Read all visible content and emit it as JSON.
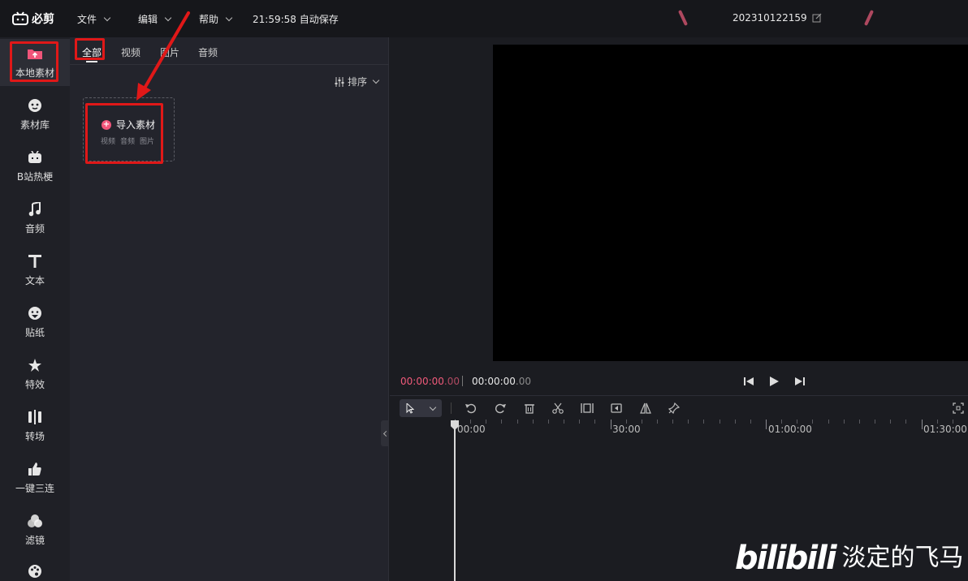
{
  "app": {
    "logo_text": "必剪",
    "menus": [
      "文件",
      "编辑",
      "帮助"
    ],
    "autosave": "21:59:58 自动保存",
    "project_name": "202310122159"
  },
  "sidebar": {
    "items": [
      {
        "label": "本地素材",
        "icon": "upload-folder-icon"
      },
      {
        "label": "素材库",
        "icon": "face-icon"
      },
      {
        "label": "B站热梗",
        "icon": "tv-icon"
      },
      {
        "label": "音频",
        "icon": "music-note-icon"
      },
      {
        "label": "文本",
        "icon": "text-t-icon"
      },
      {
        "label": "贴纸",
        "icon": "sticker-icon"
      },
      {
        "label": "特效",
        "icon": "star-icon"
      },
      {
        "label": "转场",
        "icon": "transition-icon"
      },
      {
        "label": "一键三连",
        "icon": "thumbs-up-icon"
      },
      {
        "label": "滤镜",
        "icon": "filter-icon"
      },
      {
        "label": "",
        "icon": "palette-icon"
      }
    ]
  },
  "media": {
    "tabs": [
      "全部",
      "视频",
      "图片",
      "音频"
    ],
    "sort_label": "排序",
    "import": {
      "title": "导入素材",
      "types": [
        "视频",
        "音频",
        "图片"
      ]
    }
  },
  "player": {
    "current_main": "00:00:00",
    "current_ms": ".00",
    "total_main": "00:00:00",
    "total_ms": ".00"
  },
  "timeline": {
    "ruler_labels": [
      "00:00",
      "30:00",
      "01:00:00",
      "01:30:00"
    ]
  },
  "watermark": {
    "logo": "bilibili",
    "user": "淡定的飞马"
  },
  "colors": {
    "accent": "#f05a7a",
    "highlight": "#e01818"
  }
}
